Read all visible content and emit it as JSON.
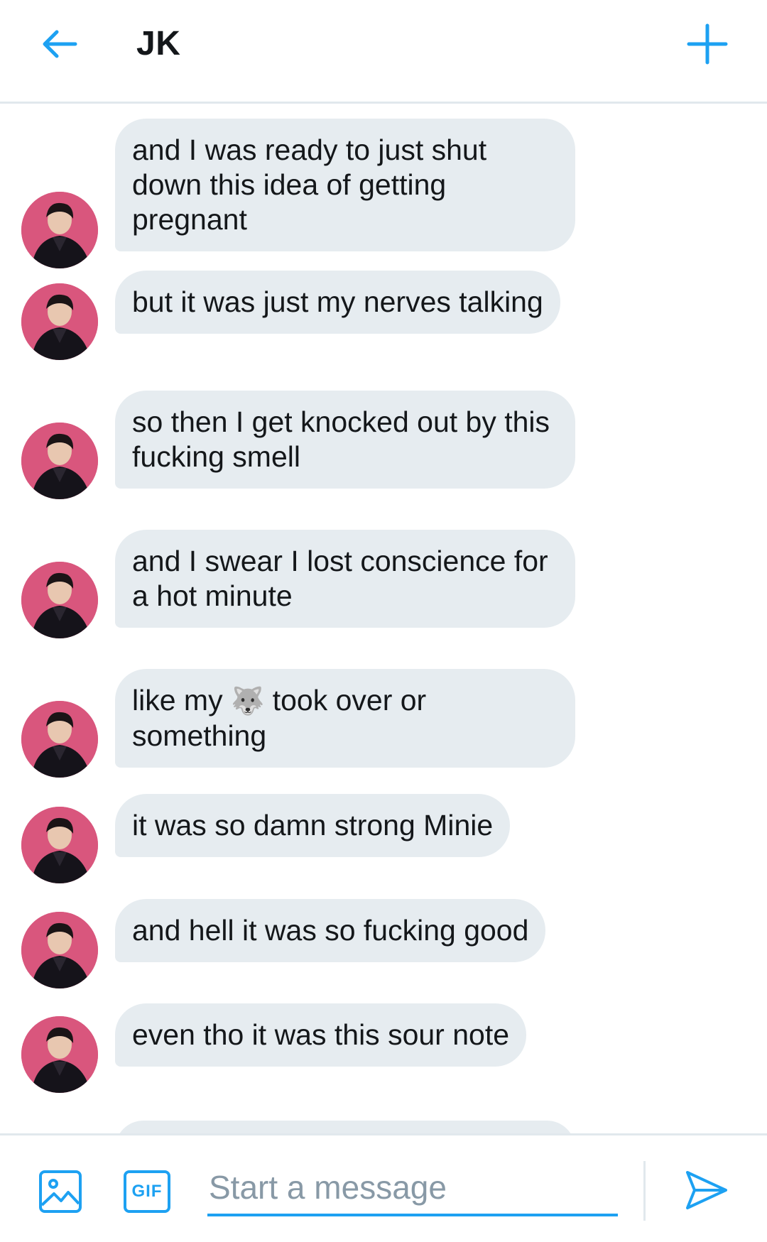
{
  "header": {
    "title": "JK",
    "back_icon": "arrow-left-icon",
    "new_icon": "plus-icon",
    "accent": "#1da1f2"
  },
  "messages": [
    {
      "text": "and I was ready to just shut down this idea of getting pregnant"
    },
    {
      "text": "but it was just my nerves talking"
    },
    {
      "text": "so then I get knocked out by this fucking smell"
    },
    {
      "text": "and I swear I lost conscience for a hot minute"
    },
    {
      "text_before": "like my",
      "emoji": "🐺",
      "text_after": "took over or something"
    },
    {
      "text": "it was so damn strong Minie"
    },
    {
      "text": "and hell it was so fucking good"
    },
    {
      "text": "even tho it was this sour note"
    }
  ],
  "avatar": {
    "color": "#d9567d",
    "icon": "avatar-photo"
  },
  "composer": {
    "placeholder": "Start a message",
    "gif_label": "GIF",
    "media_icon": "image-icon",
    "send_icon": "send-icon"
  }
}
